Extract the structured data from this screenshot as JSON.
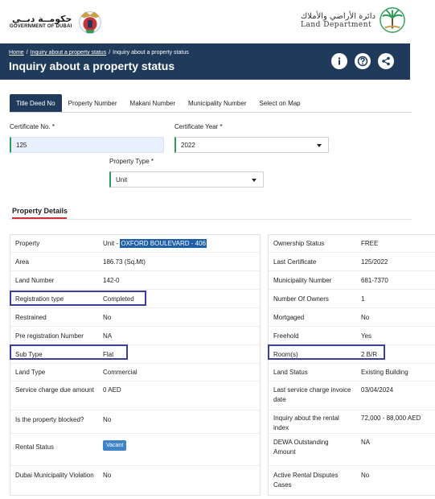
{
  "branding": {
    "gov_arabic": "حكومــة دبــي",
    "gov_english": "GOVERNMENT OF DUBAI",
    "land_arabic": "دائرة الأراضي والأملاك",
    "land_english": "Land Department"
  },
  "breadcrumb": {
    "home": "Home",
    "sep": "/",
    "parent": "Inquiry about a property status",
    "current": "Inquiry about a property status"
  },
  "page_title": "Inquiry about a property status",
  "header_icons": [
    "info-icon",
    "help-icon",
    "share-icon"
  ],
  "tabs": [
    {
      "label": "Title Deed No",
      "active": true
    },
    {
      "label": "Property Number",
      "active": false
    },
    {
      "label": "Makani Number",
      "active": false
    },
    {
      "label": "Municipality Number",
      "active": false
    },
    {
      "label": "Select on Map",
      "active": false
    }
  ],
  "form": {
    "certificate_no_label": "Certificate No. *",
    "certificate_no_value": "125",
    "certificate_year_label": "Certificate Year *",
    "certificate_year_value": "2022",
    "property_type_label": "Property Type *",
    "property_type_value": "Unit"
  },
  "section_title": "Property Details",
  "left_details": [
    {
      "key": "Property",
      "value_prefix": "Unit - ",
      "value_highlight": "OXFORD BOULEVARD - 406"
    },
    {
      "key": "Area",
      "value": "186.73 (Sq.Mt)"
    },
    {
      "key": "Land Number",
      "value": "142-0"
    },
    {
      "key": "Registration type",
      "value": "Completed"
    },
    {
      "key": "Restrained",
      "value": "No"
    },
    {
      "key": "Pre registration Number",
      "value": "NA"
    },
    {
      "key": "Sub Type",
      "value": "Flat"
    },
    {
      "key": "Land Type",
      "value": "Commercial"
    },
    {
      "key": "Service charge due amount",
      "value": "0 AED"
    },
    {
      "key": "Is the property blocked?",
      "value": "No"
    },
    {
      "key": "Rental Status",
      "value": "Vacant"
    },
    {
      "key": "Dubai Municipality Violation",
      "value": "No"
    }
  ],
  "right_details": [
    {
      "key": "Ownership Status",
      "value": "FREE"
    },
    {
      "key": "Last Certificate",
      "value": "125/2022"
    },
    {
      "key": "Municipality Number",
      "value": "681-7370"
    },
    {
      "key": "Number Of Owners",
      "value": "1"
    },
    {
      "key": "Mortgaged",
      "value": "No"
    },
    {
      "key": "Freehold",
      "value": "Yes"
    },
    {
      "key": "Room(s)",
      "value": "2 B/R"
    },
    {
      "key": "Land Status",
      "value": "Existing Building"
    },
    {
      "key": "Last service charge invoice date",
      "value": "03/04/2024"
    },
    {
      "key": "Inquiry about the rental index",
      "value": "72,000 - 88,000 AED"
    },
    {
      "key": "DEWA Outstanding Amount",
      "value": "NA"
    },
    {
      "key": "Active Rental Disputes Cases",
      "value": "No"
    }
  ],
  "colors": {
    "header_bg": "#1f3a5b",
    "active_tab": "#1f3a5b",
    "field_accent": "#2e9c57",
    "section_accent": "#c7323b",
    "callout_border": "#3b3e9a",
    "badge_bg": "#3f84c8"
  }
}
